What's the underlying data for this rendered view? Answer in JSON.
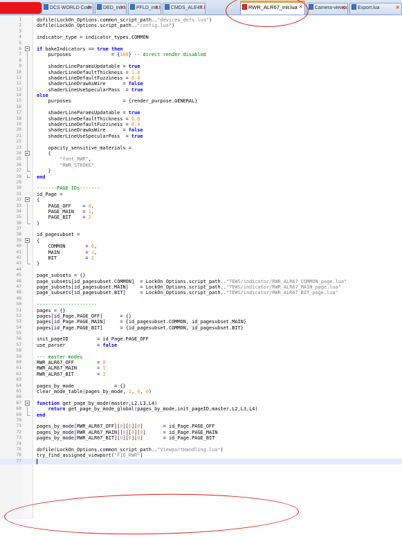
{
  "tabs": [
    {
      "label": "",
      "active": false
    },
    {
      "label": "DCS WORLD Code compiler",
      "active": false
    },
    {
      "label": "DED_init.lua",
      "active": false
    },
    {
      "label": "PFLD_init.lua",
      "active": false
    },
    {
      "label": "CMDS_ALE47.lua",
      "active": false
    },
    {
      "label": "RWR_ALR67_init.lua",
      "active": true
    },
    {
      "label": "Camera-viewports.lua",
      "active": false
    },
    {
      "label": "Export.lua",
      "active": false
    }
  ],
  "colors": {
    "annotation": "#e01818",
    "keyword": "#0000ff",
    "string": "#808080",
    "number": "#ff8000",
    "comment": "#008000"
  },
  "icons": {
    "tab_file": "lua-file-icon",
    "tab_close": "close-icon",
    "fold_open": "fold-minus-icon"
  },
  "code_lines": [
    "dofile(LockOn_Options.common_script_path..\"devices_defs.lua\")",
    "dofile(LockOn_Options.script_path..\"config.lua\")",
    "",
    "indicator_type = indicator_types.COMMON",
    "",
    "if bakeIndicators == true then",
    "    purposes              = {100} -- direct render disabled",
    "",
    "    shaderLineParamsUpdatable = true",
    "    shaderLineDefaultThickness = 1.8",
    "    shaderLineDefaultFuzziness = 0.4",
    "    shaderLineDrawAsWire      = false",
    "    shaderLineUseSpecularPass  = true",
    "else",
    "    purposes                  = {render_purpose.GENERAL}",
    "",
    "    shaderLineParamsUpdatable = true",
    "    shaderLineDefaultThickness = 0.8",
    "    shaderLineDefaultFuzziness = 0.4",
    "    shaderLineDrawAsWire      = false",
    "    shaderLineUseSpecularPass  = true",
    "",
    "    opacity_sensitive_materials =",
    "    {",
    "        \"font_RWR\",",
    "        \"RWR_STROKE\"",
    "    }",
    "end",
    "",
    "-------PAGE IDs-------",
    "id_Page =",
    "{",
    "    PAGE_OFF    = 0,",
    "    PAGE_MAIN   = 1,",
    "    PAGE_BIT    = 2",
    "}",
    "",
    "id_pagesubset =",
    "{",
    "    COMMON       = 0,",
    "    MAIN         = 1,",
    "    BIT          = 2",
    "}",
    "",
    "page_subsets = {}",
    "page_subsets[id_pagesubset.COMMON]  = LockOn_Options.script_path..\"TEWS/indicator/RWR_ALR67_COMMON_page.lua\"",
    "page_subsets[id_pagesubset.MAIN]    = LockOn_Options.script_path..\"TEWS/indicator/RWR_ALR67_MAIN_page.lua\"",
    "page_subsets[id_pagesubset.BIT]     = LockOn_Options.script_path..\"TEWS/indicator/RWR_ALR67_BIT_page.lua\"",
    "",
    "---------------------",
    "pages = {}",
    "pages[id_Page.PAGE_OFF]      = {}",
    "pages[id_Page.PAGE_MAIN]     = {id_pagesubset.COMMON, id_pagesubset.MAIN}",
    "pages[id_Page.PAGE_BIT]      = {id_pagesubset.COMMON, id_pagesubset.BIT}",
    "",
    "init_pageID          = id_Page.PAGE_OFF",
    "use_parser           = false",
    "",
    "--- master modes",
    "RWR_ALR67_OFF        = 0",
    "RWR_ALR67_MAIN       = 1",
    "RWR_ALR67_BIT        = 2",
    "",
    "pages_by_mode              = {}",
    "clear_mode_table(pages_by_mode, 2, 0, 0)",
    "",
    "function get_page_by_mode(master,L2,L3,L4)",
    "    return get_page_by_mode_global(pages_by_mode,init_pageID,master,L2,L3,L4)",
    "end",
    "",
    "pages_by_mode[RWR_ALR67_OFF][0][0][0]       = id_Page.PAGE_OFF",
    "pages_by_mode[RWR_ALR67_MAIN][0][0][0]      = id_Page.PAGE_MAIN",
    "pages_by_mode[RWR_ALR67_BIT][0][0][0]       = id_Page.PAGE_BIT",
    "",
    "dofile(LockOn_Options.common_script_path..\"ViewportHandling.lua\")",
    "try_find_assigned_viewport(\"F16_RWR\")",
    ""
  ],
  "current_line": 77,
  "fold_markers": {
    "6": "box",
    "7": "line",
    "8": "line",
    "9": "line",
    "10": "line",
    "11": "line",
    "12": "line",
    "13": "line",
    "14": "line",
    "15": "line",
    "16": "line",
    "17": "line",
    "18": "line",
    "19": "line",
    "20": "line",
    "21": "line",
    "22": "line",
    "23": "line",
    "24": "box",
    "25": "line",
    "26": "line",
    "27": "end",
    "28": "end",
    "32": "box",
    "33": "line",
    "34": "line",
    "35": "line",
    "36": "end",
    "39": "box",
    "40": "line",
    "41": "line",
    "42": "line",
    "43": "end",
    "67": "box",
    "68": "line",
    "69": "end"
  }
}
